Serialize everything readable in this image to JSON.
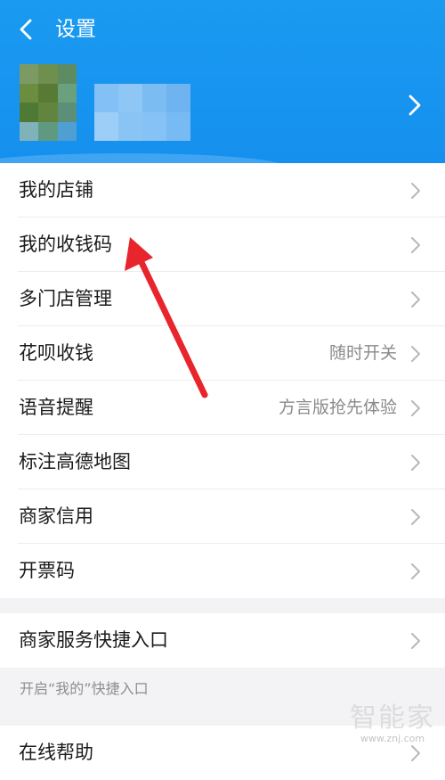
{
  "header": {
    "title": "设置",
    "back_icon": "chevron-left-icon",
    "profile_chevron_icon": "chevron-right-icon",
    "background_color": "#1a96f0"
  },
  "menu_group_1": [
    {
      "label": "我的店铺",
      "value": ""
    },
    {
      "label": "我的收钱码",
      "value": ""
    },
    {
      "label": "多门店管理",
      "value": ""
    },
    {
      "label": "花呗收钱",
      "value": "随时开关"
    },
    {
      "label": "语音提醒",
      "value": "方言版抢先体验"
    },
    {
      "label": "标注高德地图",
      "value": ""
    },
    {
      "label": "商家信用",
      "value": ""
    },
    {
      "label": "开票码",
      "value": ""
    }
  ],
  "menu_group_2": [
    {
      "label": "商家服务快捷入口",
      "value": ""
    }
  ],
  "hint": "开启“我的”快捷入口",
  "menu_group_3": [
    {
      "label": "在线帮助",
      "value": ""
    }
  ],
  "watermark": {
    "text": "智能家",
    "url": "www.znj.com"
  },
  "annotation": {
    "arrow_color": "#e8242c"
  }
}
